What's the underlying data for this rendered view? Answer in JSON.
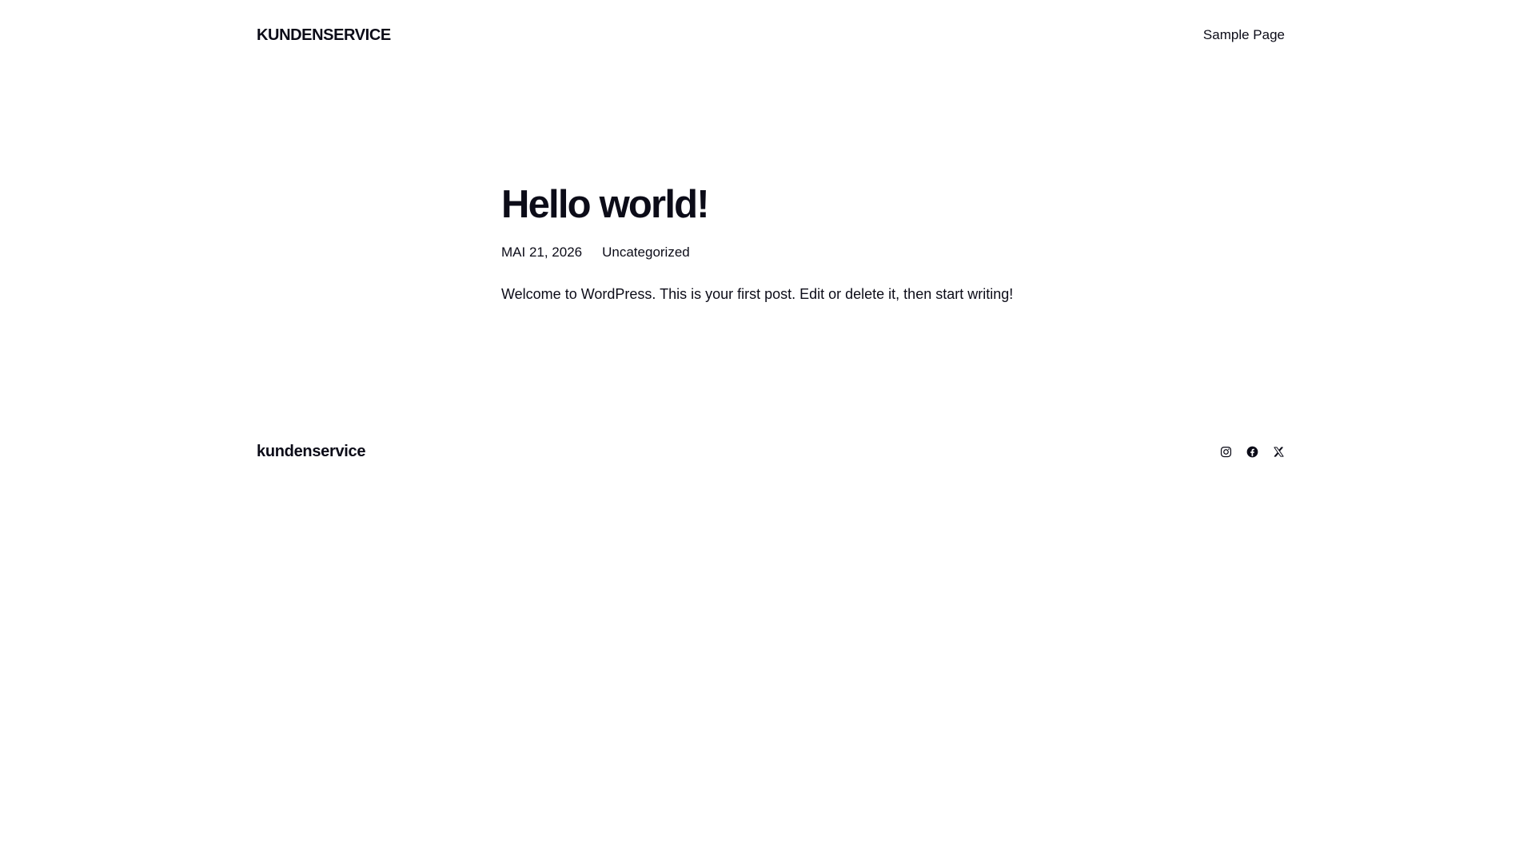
{
  "header": {
    "site_title": "KUNDENSERVICE",
    "nav": [
      {
        "label": "Sample Page"
      }
    ]
  },
  "post": {
    "title": "Hello world!",
    "date": "MAI 21, 2026",
    "category": "Uncategorized",
    "excerpt": "Welcome to WordPress. This is your first post. Edit or delete it, then start writing!"
  },
  "footer": {
    "site_title": "kundenservice",
    "social": [
      {
        "name": "instagram-icon"
      },
      {
        "name": "facebook-icon"
      },
      {
        "name": "x-icon"
      }
    ]
  },
  "colors": {
    "text": "#0c0c18",
    "background": "#ffffff"
  }
}
